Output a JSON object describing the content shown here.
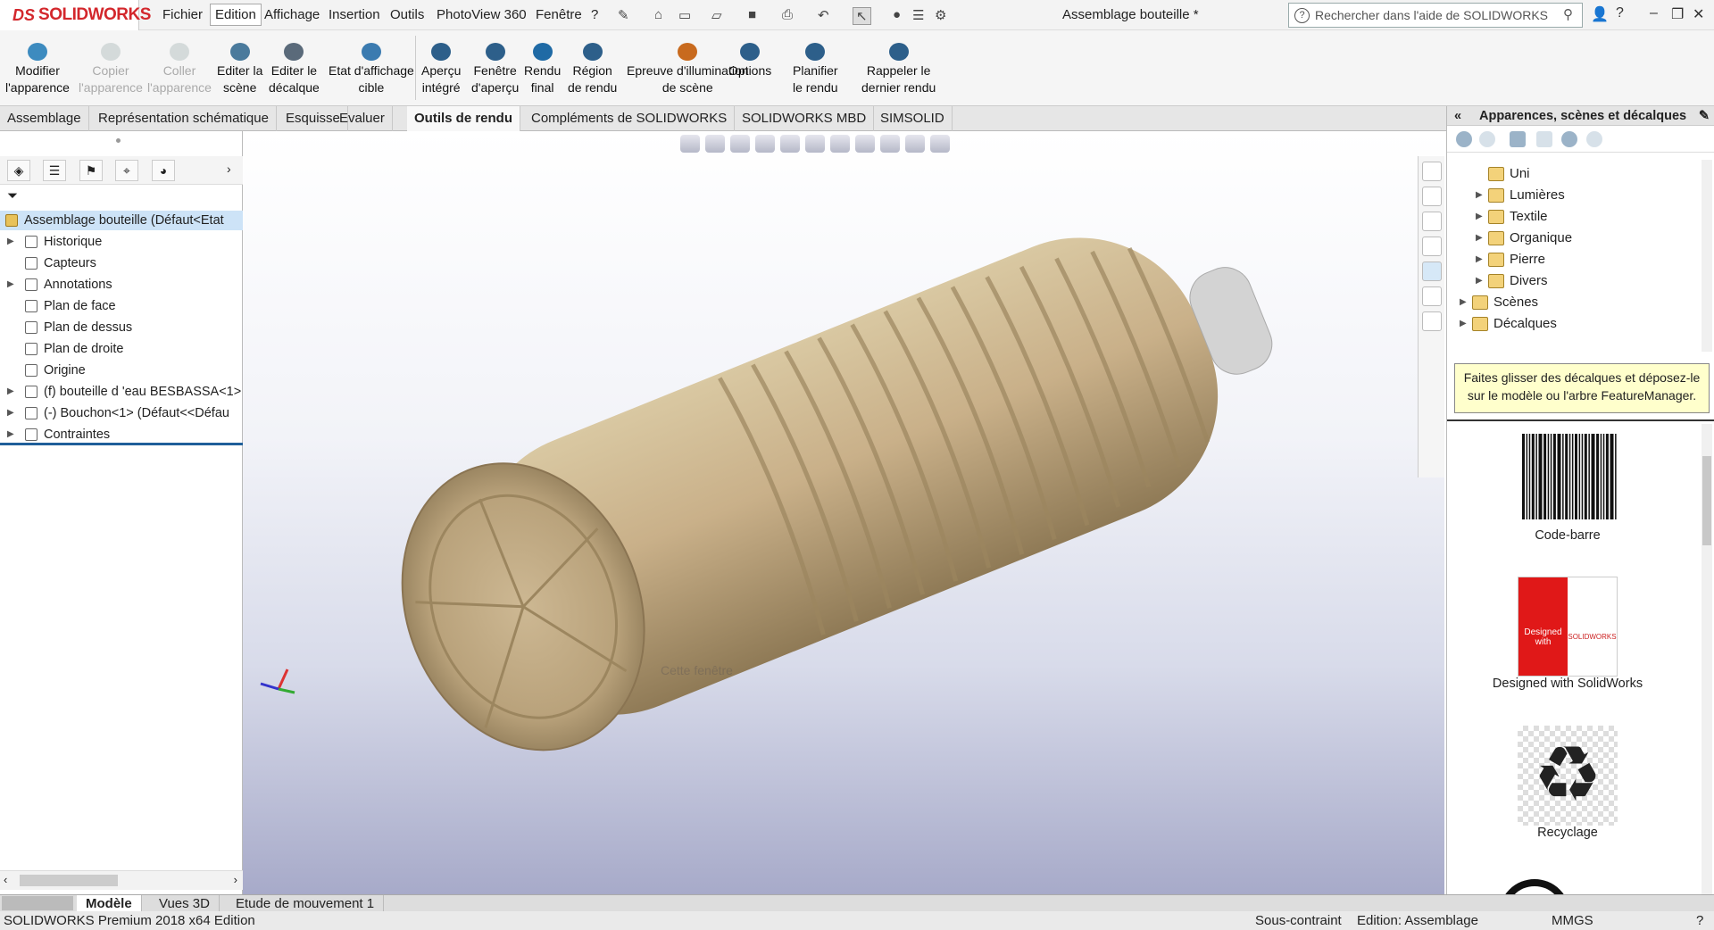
{
  "app": {
    "logo_prefix": "DS",
    "logo_text": "SOLIDWORKS",
    "document_title": "Assemblage bouteille *"
  },
  "menu": [
    "Fichier",
    "Edition",
    "Affichage",
    "Insertion",
    "Outils",
    "PhotoView 360",
    "Fenêtre",
    "?"
  ],
  "search": {
    "placeholder": "Rechercher dans l'aide de SOLIDWORKS"
  },
  "ribbon": [
    {
      "l1": "Modifier",
      "l2": "l'apparence",
      "enabled": true,
      "icon": "modify-appearance-icon",
      "color": "#3d8bbf"
    },
    {
      "l1": "Copier",
      "l2": "l'apparence",
      "enabled": false,
      "icon": "copy-appearance-icon",
      "color": "#9aa"
    },
    {
      "l1": "Coller",
      "l2": "l'apparence",
      "enabled": false,
      "icon": "paste-appearance-icon",
      "color": "#9aa"
    },
    {
      "l1": "Editer la",
      "l2": "scène",
      "enabled": true,
      "icon": "edit-scene-icon",
      "color": "#4a7a9c"
    },
    {
      "l1": "Editer le",
      "l2": "décalque",
      "enabled": true,
      "icon": "edit-decal-icon",
      "color": "#5a6a7a"
    },
    {
      "l1": "Etat d'affichage",
      "l2": "cible",
      "enabled": true,
      "icon": "target-display-state-icon",
      "color": "#3b7bb0"
    },
    {
      "l1": "Aperçu",
      "l2": "intégré",
      "enabled": true,
      "icon": "integrated-preview-icon",
      "color": "#2d5f8a"
    },
    {
      "l1": "Fenêtre",
      "l2": "d'aperçu",
      "enabled": true,
      "icon": "preview-window-icon",
      "color": "#2d5f8a"
    },
    {
      "l1": "Rendu",
      "l2": "final",
      "enabled": true,
      "icon": "final-render-icon",
      "color": "#1f6aa5"
    },
    {
      "l1": "Région",
      "l2": "de rendu",
      "enabled": true,
      "icon": "render-region-icon",
      "color": "#2d5f8a"
    },
    {
      "l1": "Epreuve d'illumination",
      "l2": "de scène",
      "enabled": true,
      "icon": "scene-illumination-proof-icon",
      "color": "#c86a1e"
    },
    {
      "l1": "Options",
      "l2": "",
      "enabled": true,
      "icon": "options-icon",
      "color": "#2d5f8a"
    },
    {
      "l1": "Planifier",
      "l2": "le rendu",
      "enabled": true,
      "icon": "schedule-render-icon",
      "color": "#2d5f8a"
    },
    {
      "l1": "Rappeler le",
      "l2": "dernier rendu",
      "enabled": true,
      "icon": "recall-last-render-icon",
      "color": "#2d5f8a"
    }
  ],
  "tabs": [
    "Assemblage",
    "Représentation schématique",
    "Esquisse",
    "Evaluer",
    "Outils de rendu",
    "Compléments de SOLIDWORKS",
    "SOLIDWORKS MBD",
    "SIMSOLID"
  ],
  "active_tab": "Outils de rendu",
  "tree": {
    "root": "Assemblage bouteille  (Défaut<Etat",
    "items": [
      {
        "label": "Historique",
        "expandable": true
      },
      {
        "label": "Capteurs",
        "expandable": false
      },
      {
        "label": "Annotations",
        "expandable": true
      },
      {
        "label": "Plan de face",
        "expandable": false
      },
      {
        "label": "Plan de dessus",
        "expandable": false
      },
      {
        "label": "Plan de droite",
        "expandable": false
      },
      {
        "label": "Origine",
        "expandable": false
      },
      {
        "label": "(f) bouteille d 'eau BESBASSA<1>",
        "expandable": true
      },
      {
        "label": "(-) Bouchon<1> (Défaut<<Défau",
        "expandable": true
      },
      {
        "label": "Contraintes",
        "expandable": true
      }
    ]
  },
  "viewport": {
    "watermark": "Cette fenêtre"
  },
  "right_panel": {
    "title": "Apparences, scènes et décalques",
    "tree": [
      {
        "label": "Uni",
        "indent": 1,
        "expandable": false
      },
      {
        "label": "Lumières",
        "indent": 1,
        "expandable": true
      },
      {
        "label": "Textile",
        "indent": 1,
        "expandable": true
      },
      {
        "label": "Organique",
        "indent": 1,
        "expandable": true
      },
      {
        "label": "Pierre",
        "indent": 1,
        "expandable": true
      },
      {
        "label": "Divers",
        "indent": 1,
        "expandable": true
      },
      {
        "label": "Scènes",
        "indent": 0,
        "expandable": true
      },
      {
        "label": "Décalques",
        "indent": 0,
        "expandable": true
      }
    ],
    "tip": "Faites glisser des décalques et déposez-le sur le modèle ou l'arbre FeatureManager.",
    "decals": [
      {
        "label": "Code-barre"
      },
      {
        "label": "Designed with SolidWorks",
        "thumb_left": "Designed with",
        "thumb_right": "SOLIDWORKS"
      },
      {
        "label": "Recyclage"
      }
    ]
  },
  "bottom_tabs": [
    "Modèle",
    "Vues 3D",
    "Etude de mouvement 1"
  ],
  "status": {
    "edition": "SOLIDWORKS Premium 2018 x64 Edition",
    "constraint": "Sous-contraint",
    "editing": "Edition: Assemblage",
    "units": "MMGS"
  }
}
